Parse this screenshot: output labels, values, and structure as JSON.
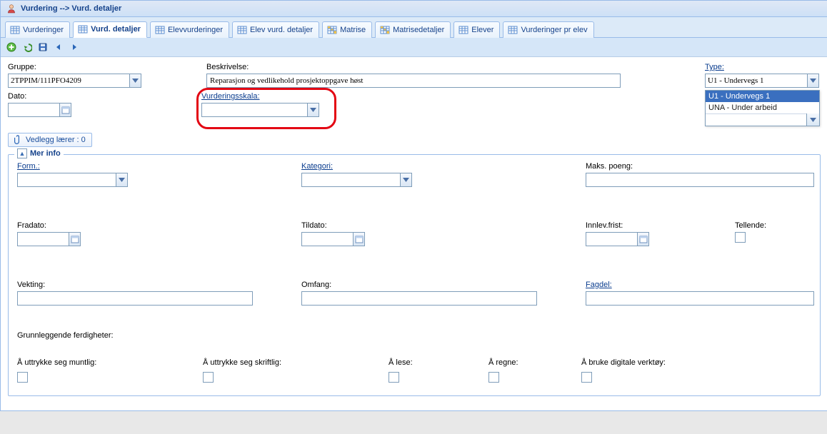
{
  "header": {
    "title": "Vurdering --> Vurd. detaljer"
  },
  "tabs": [
    {
      "label": "Vurderinger"
    },
    {
      "label": "Vurd. detaljer"
    },
    {
      "label": "Elevvurderinger"
    },
    {
      "label": "Elev vurd. detaljer"
    },
    {
      "label": "Matrise"
    },
    {
      "label": "Matrisedetaljer"
    },
    {
      "label": "Elever"
    },
    {
      "label": "Vurderinger pr elev"
    }
  ],
  "top": {
    "gruppe_label": "Gruppe:",
    "gruppe_value": "2TPPIM/111PFO4209",
    "beskrivelse_label": "Beskrivelse:",
    "beskrivelse_value": "Reparasjon og vedlikehold prosjektoppgave høst",
    "type_label": "Type:",
    "type_value": "U1 - Undervegs 1",
    "type_options": [
      "U1 - Undervegs 1",
      "UNA - Under arbeid"
    ],
    "dato_label": "Dato:",
    "vskala_label": "Vurderingsskala:"
  },
  "vedlegg_label": "Vedlegg lærer : 0",
  "merinfo": {
    "title": "Mer info",
    "form_label": "Form.:",
    "kategori_label": "Kategori:",
    "maks_label": "Maks. poeng:",
    "fradato_label": "Fradato:",
    "tildato_label": "Tildato:",
    "innlev_label": "Innlev.frist:",
    "tellende_label": "Tellende:",
    "vekting_label": "Vekting:",
    "omfang_label": "Omfang:",
    "fagdel_label": "Fagdel:",
    "grunn_label": "Grunnleggende ferdigheter:",
    "ferd": [
      "Å uttrykke seg muntlig:",
      "Å uttrykke seg skriftlig:",
      "Å lese:",
      "Å regne:",
      "Å bruke digitale verktøy:"
    ]
  }
}
